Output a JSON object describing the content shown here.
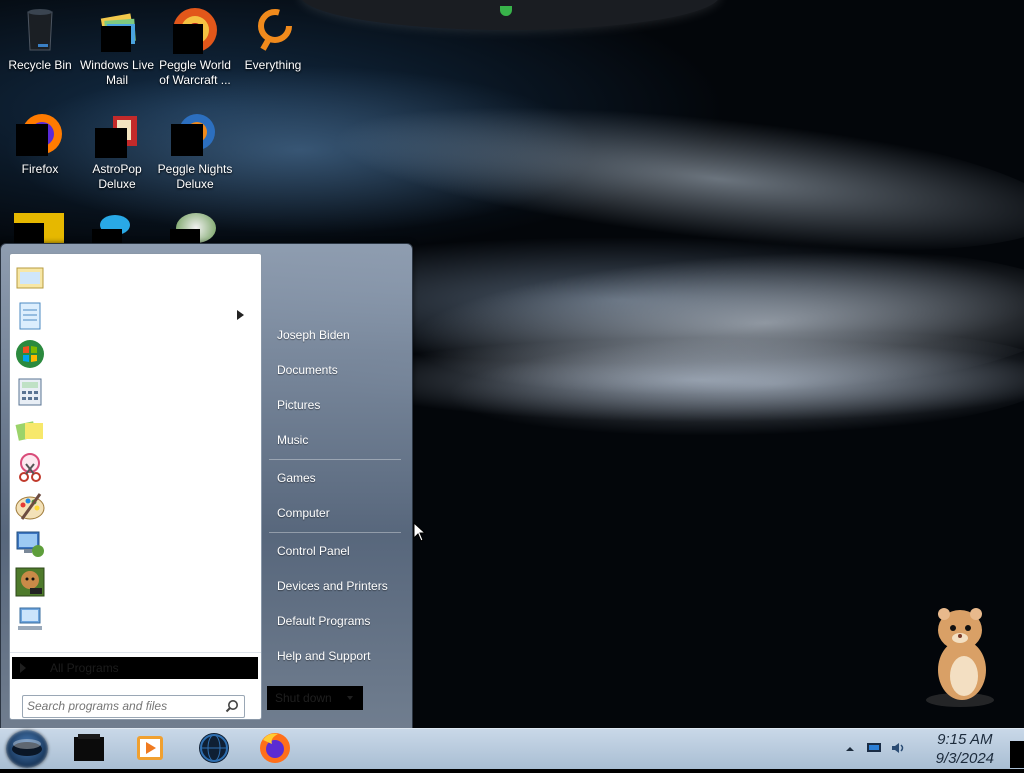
{
  "desktop": {
    "icons": [
      {
        "label": "Recycle Bin"
      },
      {
        "label": "Windows Live Mail"
      },
      {
        "label": "Peggle World of Warcraft ..."
      },
      {
        "label": "Everything"
      },
      {
        "label": "Firefox"
      },
      {
        "label": "AstroPop Deluxe"
      },
      {
        "label": "Peggle Nights Deluxe"
      }
    ]
  },
  "start_menu": {
    "pinned_icons": [
      "mail-icon",
      "notepad-icon",
      "getting-started-icon",
      "calculator-icon",
      "sticky-notes-icon",
      "snipping-tool-icon",
      "paint-icon",
      "remote-desktop-icon",
      "game-box-icon",
      "network-computer-icon"
    ],
    "all_programs": "All Programs",
    "search_placeholder": "Search programs and files",
    "right_items": [
      "Joseph Biden",
      "Documents",
      "Pictures",
      "Music",
      "Games",
      "Computer",
      "Control Panel",
      "Devices and Printers",
      "Default Programs",
      "Help and Support"
    ],
    "shutdown_label": "Shut down"
  },
  "taskbar": {
    "pinned": [
      "explorer-icon",
      "media-player-icon",
      "network-globe-icon",
      "firefox-icon"
    ],
    "time": "9:15 AM",
    "date": "9/3/2024"
  },
  "colors": {
    "taskbar": "#b9cbdd",
    "start_menu_glass": "#7a8ca3",
    "left_pane": "#ffffff"
  }
}
